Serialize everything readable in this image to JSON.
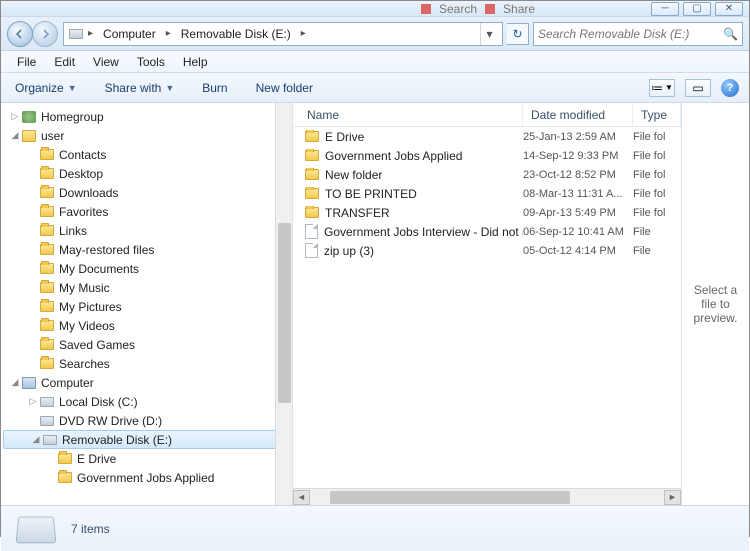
{
  "titlebar": {
    "search_hint": "Search",
    "share_hint": "Share"
  },
  "nav": {
    "breadcrumb": [
      "Computer",
      "Removable Disk (E:)"
    ],
    "search_placeholder": "Search Removable Disk (E:)"
  },
  "menubar": [
    "File",
    "Edit",
    "View",
    "Tools",
    "Help"
  ],
  "toolbar": {
    "organize": "Organize",
    "share": "Share with",
    "burn": "Burn",
    "newfolder": "New folder"
  },
  "tree": {
    "homegroup": "Homegroup",
    "user": "user",
    "user_children": [
      "Contacts",
      "Desktop",
      "Downloads",
      "Favorites",
      "Links",
      "May-restored files",
      "My Documents",
      "My Music",
      "My Pictures",
      "My Videos",
      "Saved Games",
      "Searches"
    ],
    "computer": "Computer",
    "local_disk": "Local Disk (C:)",
    "dvd": "DVD RW Drive (D:)",
    "removable": "Removable Disk (E:)",
    "removable_children": [
      "E Drive",
      "Government Jobs Applied"
    ]
  },
  "columns": {
    "name": "Name",
    "date": "Date modified",
    "type": "Type"
  },
  "files": [
    {
      "name": "E Drive",
      "date": "25-Jan-13 2:59 AM",
      "type": "File fol",
      "icon": "folder"
    },
    {
      "name": "Government Jobs Applied",
      "date": "14-Sep-12 9:33 PM",
      "type": "File fol",
      "icon": "folder"
    },
    {
      "name": "New folder",
      "date": "23-Oct-12 8:52 PM",
      "type": "File fol",
      "icon": "folder"
    },
    {
      "name": "TO BE PRINTED",
      "date": "08-Mar-13 11:31 A...",
      "type": "File fol",
      "icon": "folder"
    },
    {
      "name": "TRANSFER",
      "date": "09-Apr-13 5:49 PM",
      "type": "File fol",
      "icon": "folder"
    },
    {
      "name": "Government Jobs Interview - Did not atte...",
      "date": "06-Sep-12 10:41 AM",
      "type": "File",
      "icon": "file"
    },
    {
      "name": "zip up (3)",
      "date": "05-Oct-12 4:14 PM",
      "type": "File",
      "icon": "file"
    }
  ],
  "preview": {
    "text": "Select a file to preview."
  },
  "status": {
    "count": "7 items"
  }
}
